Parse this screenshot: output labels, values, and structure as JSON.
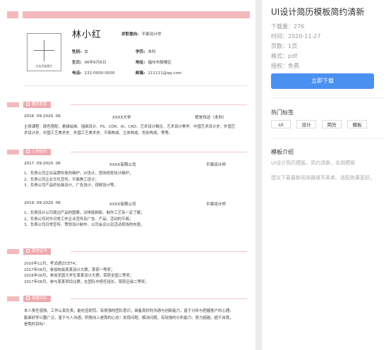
{
  "resume": {
    "name": "林小红",
    "photo_label": "点击添加图片",
    "info": {
      "gender_label": "性别:",
      "gender": "女",
      "birthday_label": "生日:",
      "birthday": "96年6月6日",
      "phone_label": "电话:",
      "phone": "132-0000-0000",
      "job_label": "求职意向:",
      "job": "平面设计师",
      "edu_label": "学历:",
      "edu": "本科",
      "address_label": "地址:",
      "address": "福州市鼓楼区",
      "email_label": "邮箱:",
      "email": "111111@qq.com"
    },
    "sections": {
      "education": "教育背景",
      "work": "工作经历",
      "certificates": "荣誉证书",
      "self_eval": "自我评价"
    },
    "education": {
      "period": "2016. 09-2020. 06",
      "school": "XXXX大学",
      "major": "视觉传达（本科）",
      "courses": "主修课程：颜色搭配、素描绘画、插画设计、PS、CDR、AI、CAD、艺术设计概论、艺术设计美学、中国艺术设计史、外国艺术设计史、中国工艺美术史、外国工艺美术史、平面构成、立体构成、色彩构成、等等。"
    },
    "work": [
      {
        "period": "2017. 09-2020. 06",
        "company": "XXXX有限公司",
        "role": "平面设计师",
        "duties": [
          "1、负责公司企业品牌形象的维护，VI设计，官网视觉设计维护；",
          "2、负责公司企业文化宣传，平面美工设计；",
          "3、负责公司产品的包装设计，广告设计，视频设计等。"
        ]
      },
      {
        "period": "2019. 09-2020. 06",
        "company": "XXXX有限公司",
        "role": "平面设计师",
        "duties": [
          "1、负责设计公司周边产品的图案，对排版刷新、制作工艺有一定了解；",
          "2、负责公司对外日常工作企业宣传及广告、产品、活动的平面；",
          "3、负责公司日常宣传、策划设计制作、公司会议以及活动现场的布置。"
        ]
      }
    ],
    "certificates": [
      "2016年12月，考试通过CET4；",
      "2017年08月，参加校级某某设计大赛，荣获一等奖；",
      "2018年09月，参加全国大学生某某设计大赛，荣获全国二等奖；",
      "2017年08月，参与某某项目比赛，在团队中担任组长，荣获区级二等奖。"
    ],
    "self_eval": "本人责任感强，工作认真负责，能吃苦耐劳。有很强的团队意识，具备良好的沟通与创新能力，善于分析与把握客户的心理。勤奋好学兴趣广泛，善于与人沟通。积极向上是我的心态！发现问题，解决问题，有较强的分析能力。努力超越，超于自我，是我的目标！"
  },
  "panel": {
    "title": "UI设计简历模板简约清新",
    "downloads": "下载量：276",
    "date": "时间：2020-11-27",
    "pages": "页数：1页",
    "format": "格式：pdf",
    "license": "授权：免费",
    "download_button": "立即下载",
    "tags_heading": "热门标签",
    "tags": [
      "UI",
      "设计",
      "简历",
      "模板"
    ],
    "intro_heading": "模板介绍",
    "intro": "UI设计简历模板，简约清新，实用模板",
    "hint": "建议下载最新阅读器填写表单、适配效果更好。"
  },
  "colors": {
    "accent_pink": "#f0a8ae",
    "button_blue": "#4a90f0"
  }
}
